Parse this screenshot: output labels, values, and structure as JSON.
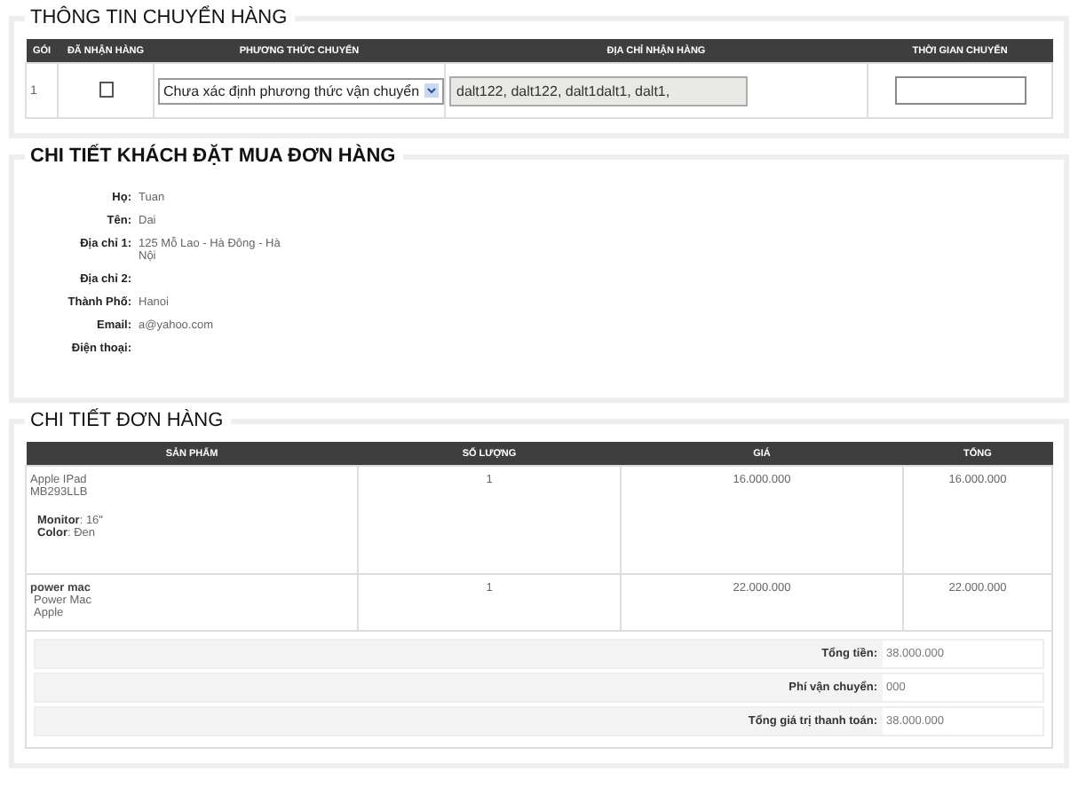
{
  "shipping": {
    "title": "THÔNG TIN CHUYỂN HÀNG",
    "columns": [
      "GÓI",
      "ĐÃ NHẬN HÀNG",
      "PHƯƠNG THỨC CHUYỂN",
      "ĐỊA CHỈ NHẬN HÀNG",
      "THỜI GIAN CHUYỂN"
    ],
    "rows": [
      {
        "package": "1",
        "received": false,
        "method": "Chưa xác định phương thức vận chuyển",
        "address": "dalt122,  dalt122,  dalt1dalt1, dalt1,"
      }
    ]
  },
  "customer": {
    "title": "CHI TIẾT KHÁCH ĐẶT MUA ĐƠN HÀNG",
    "fields": [
      {
        "label": "Họ:",
        "value": "Tuan"
      },
      {
        "label": "Tên:",
        "value": "Dai"
      },
      {
        "label": "Địa chỉ 1:",
        "value": "125 Mỗ Lao - Hà Đông - Hà Nội"
      },
      {
        "label": "Địa chỉ 2:"
      },
      {
        "label": "Thành Phố:",
        "value": "Hanoi"
      },
      {
        "label": "Email:",
        "value": "a@yahoo.com"
      },
      {
        "label": "Điện thoại:"
      }
    ]
  },
  "order": {
    "title": "CHI TIẾT ĐƠN HÀNG",
    "columns": [
      "SẢN PHẨM",
      "SỐ LƯỢNG",
      "GIÁ",
      "TỔNG"
    ],
    "rows": [
      {
        "name": "Apple IPad",
        "name_bold": false,
        "details": [
          "MB293LLB"
        ],
        "attributes": [
          "**Monitor**: 16\"",
          "**Color**: Đen"
        ],
        "quantity": "1",
        "price": "16.000.000",
        "total": "16.000.000"
      },
      {
        "name": "power mac",
        "name_bold": true,
        "details": [
          "Power Mac",
          "Apple"
        ],
        "quantity": "1",
        "price": "22.000.000",
        "total": "22.000.000"
      }
    ],
    "summary": [
      {
        "label": "Tổng tiền:",
        "value": "38.000.000"
      },
      {
        "label": "Phí vận chuyển:",
        "value": "000"
      },
      {
        "label": "Tổng giá trị thanh toán:",
        "value": "38.000.000"
      }
    ]
  }
}
